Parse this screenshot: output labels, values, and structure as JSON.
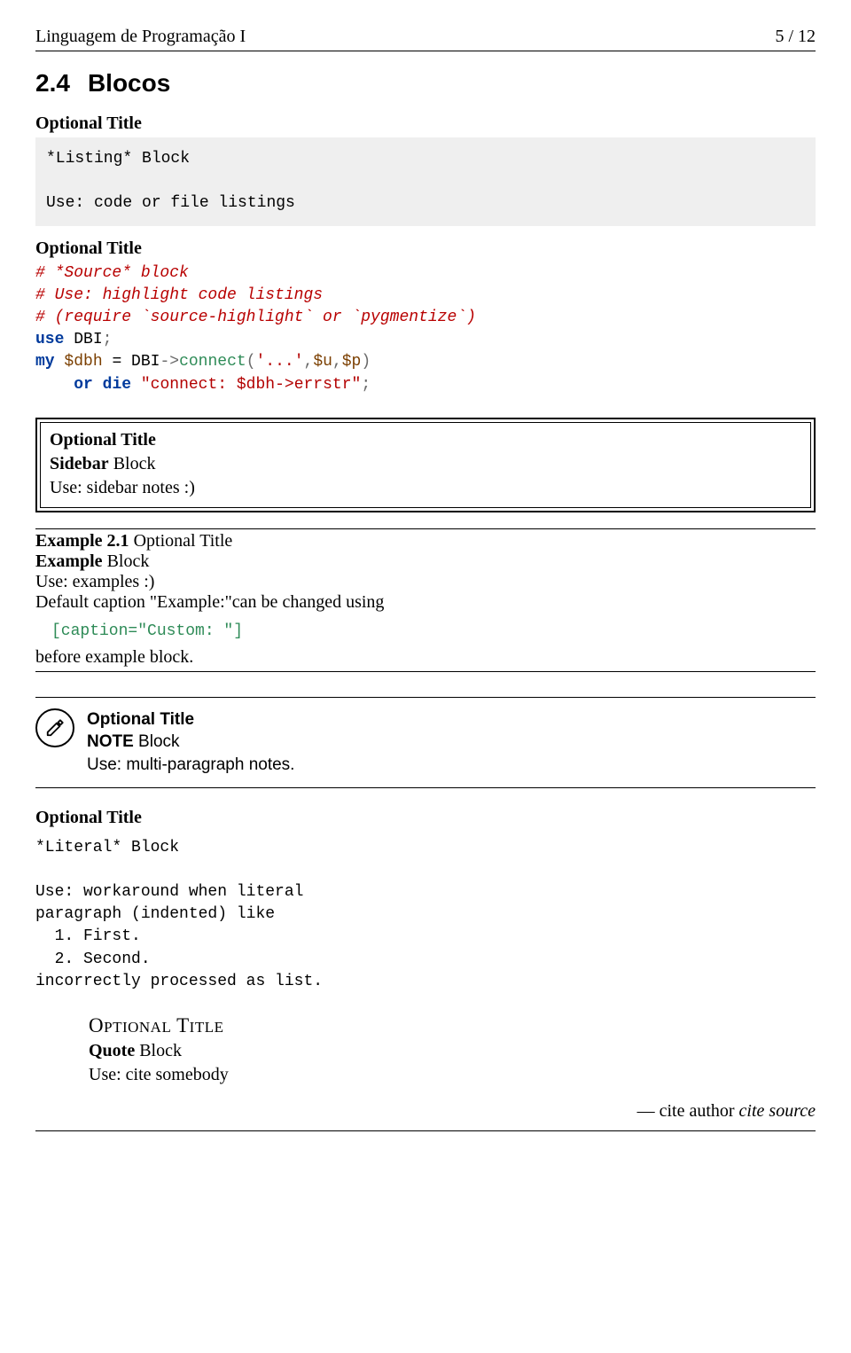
{
  "header": {
    "doc_title": "Linguagem de Programação I",
    "page_indicator": "5 / 12"
  },
  "section": {
    "number": "2.4",
    "title": "Blocos"
  },
  "listing": {
    "title": "Optional Title",
    "line1": "*Listing* Block",
    "line2": "Use: code or file listings"
  },
  "source": {
    "title": "Optional Title",
    "comment1": "# *Source* block",
    "comment2": "# Use: highlight code listings",
    "comment3": "# (require `source-highlight` or `pygmentize`)",
    "kw_use": "use",
    "pkg": "DBI",
    "semi": ";",
    "kw_my": "my",
    "var1": "$dbh",
    "eq": " = ",
    "pkg2": "DBI",
    "arrow": "->",
    "func_connect": "connect",
    "lparen": "(",
    "str1": "'...'",
    "comma1": ",",
    "var_u": "$u",
    "comma2": ",",
    "var_p": "$p",
    "rparen": ")",
    "indent": "    ",
    "kw_or": "or",
    "sp": " ",
    "kw_die": "die",
    "str2": "\"connect: $dbh->errstr\"",
    "semi2": ";"
  },
  "sidebar": {
    "title": "Optional Title",
    "name_strong": "Sidebar",
    "name_rest": " Block",
    "use": "Use: sidebar notes :)"
  },
  "example": {
    "caption_bold": "Example 2.1",
    "caption_rest": " Optional Title",
    "name_strong": "Example",
    "name_rest": " Block",
    "use": "Use: examples :)",
    "desc": "Default caption \"Example:\"can be changed using",
    "code": "[caption=\"Custom: \"]",
    "after": "before example block."
  },
  "note": {
    "title": "Optional Title",
    "name_strong": "NOTE",
    "name_rest": " Block",
    "use": "Use: multi-paragraph notes."
  },
  "literal": {
    "title": "Optional Title",
    "line1": "*Literal* Block",
    "body": "Use: workaround when literal\nparagraph (indented) like\n  1. First.\n  2. Second.\nincorrectly processed as list."
  },
  "quote": {
    "title": "OPTIONAL TITLE",
    "name_strong": "Quote",
    "name_rest": " Block",
    "use": "Use: cite somebody",
    "dash": "— ",
    "author": "cite author ",
    "source": "cite source"
  }
}
